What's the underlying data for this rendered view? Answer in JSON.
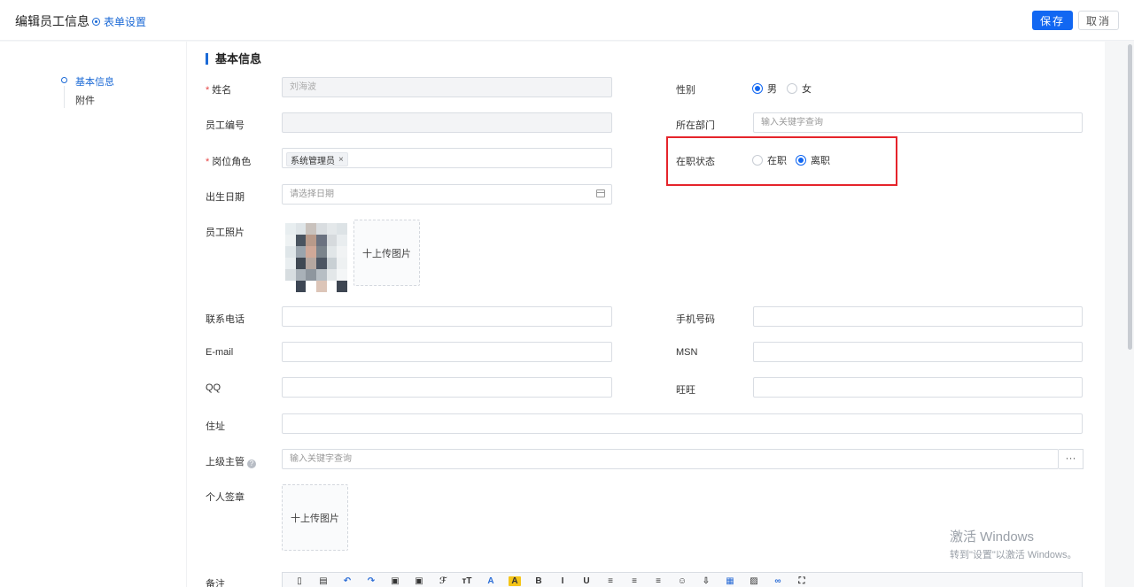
{
  "header": {
    "title": "编辑员工信息",
    "form_settings": "表单设置",
    "save": "保存",
    "cancel": "取消"
  },
  "nav": {
    "items": [
      {
        "label": "基本信息",
        "active": true
      },
      {
        "label": "附件",
        "active": false
      }
    ]
  },
  "section": {
    "title": "基本信息"
  },
  "fields": {
    "name": {
      "label": "姓名",
      "required": "*",
      "value": "刘海波"
    },
    "gender": {
      "label": "性别",
      "options": [
        "男",
        "女"
      ],
      "selected": "男"
    },
    "employee_no": {
      "label": "员工编号",
      "value": ""
    },
    "department": {
      "label": "所在部门",
      "placeholder": "输入关键字查询"
    },
    "role": {
      "label": "岗位角色",
      "required": "*",
      "tags": [
        "系统管理员"
      ],
      "tag_close": "×"
    },
    "status": {
      "label": "在职状态",
      "options": [
        "在职",
        "离职"
      ],
      "selected": "离职"
    },
    "birth": {
      "label": "出生日期",
      "placeholder": "请选择日期"
    },
    "photo": {
      "label": "员工照片",
      "upload": "十上传图片"
    },
    "phone": {
      "label": "联系电话",
      "value": ""
    },
    "mobile": {
      "label": "手机号码",
      "value": ""
    },
    "email": {
      "label": "E-mail",
      "value": ""
    },
    "msn": {
      "label": "MSN",
      "value": ""
    },
    "qq": {
      "label": "QQ",
      "value": ""
    },
    "wangwang": {
      "label": "旺旺",
      "value": ""
    },
    "address": {
      "label": "住址",
      "value": ""
    },
    "supervisor": {
      "label": "上级主管",
      "help": "?",
      "placeholder": "输入关键字查询",
      "picker": "···"
    },
    "signature": {
      "label": "个人签章",
      "upload": "十上传图片"
    },
    "remark": {
      "label": "备注"
    }
  },
  "editor_toolbar": [
    {
      "icon": "source-icon",
      "glyph": "▯"
    },
    {
      "icon": "page-icon",
      "glyph": "▤"
    },
    {
      "icon": "undo-icon",
      "glyph": "↶"
    },
    {
      "icon": "redo-icon",
      "glyph": "↷"
    },
    {
      "icon": "paste-icon",
      "glyph": "▣"
    },
    {
      "icon": "paste-text-icon",
      "glyph": "▣"
    },
    {
      "icon": "font-family-icon",
      "glyph": "ℱ"
    },
    {
      "icon": "font-size-icon",
      "glyph": "ᴛT"
    },
    {
      "icon": "font-color-icon",
      "glyph": "A"
    },
    {
      "icon": "highlight-icon",
      "glyph": "A"
    },
    {
      "icon": "bold-icon",
      "glyph": "B"
    },
    {
      "icon": "italic-icon",
      "glyph": "I"
    },
    {
      "icon": "underline-icon",
      "glyph": "U"
    },
    {
      "icon": "align-left-icon",
      "glyph": "≡"
    },
    {
      "icon": "align-center-icon",
      "glyph": "≡"
    },
    {
      "icon": "align-right-icon",
      "glyph": "≡"
    },
    {
      "icon": "emoji-icon",
      "glyph": "☺"
    },
    {
      "icon": "insert-icon",
      "glyph": "⇩"
    },
    {
      "icon": "table-icon",
      "glyph": "▦"
    },
    {
      "icon": "image-icon",
      "glyph": "▨"
    },
    {
      "icon": "link-icon",
      "glyph": "∞"
    },
    {
      "icon": "fullscreen-icon",
      "glyph": "⛶"
    }
  ],
  "watermark": {
    "line1": "激活 Windows",
    "line2": "转到\"设置\"以激活 Windows。"
  },
  "colors": {
    "primary": "#1167f2",
    "highlight_border": "#e5242b",
    "required": "#e64545"
  }
}
